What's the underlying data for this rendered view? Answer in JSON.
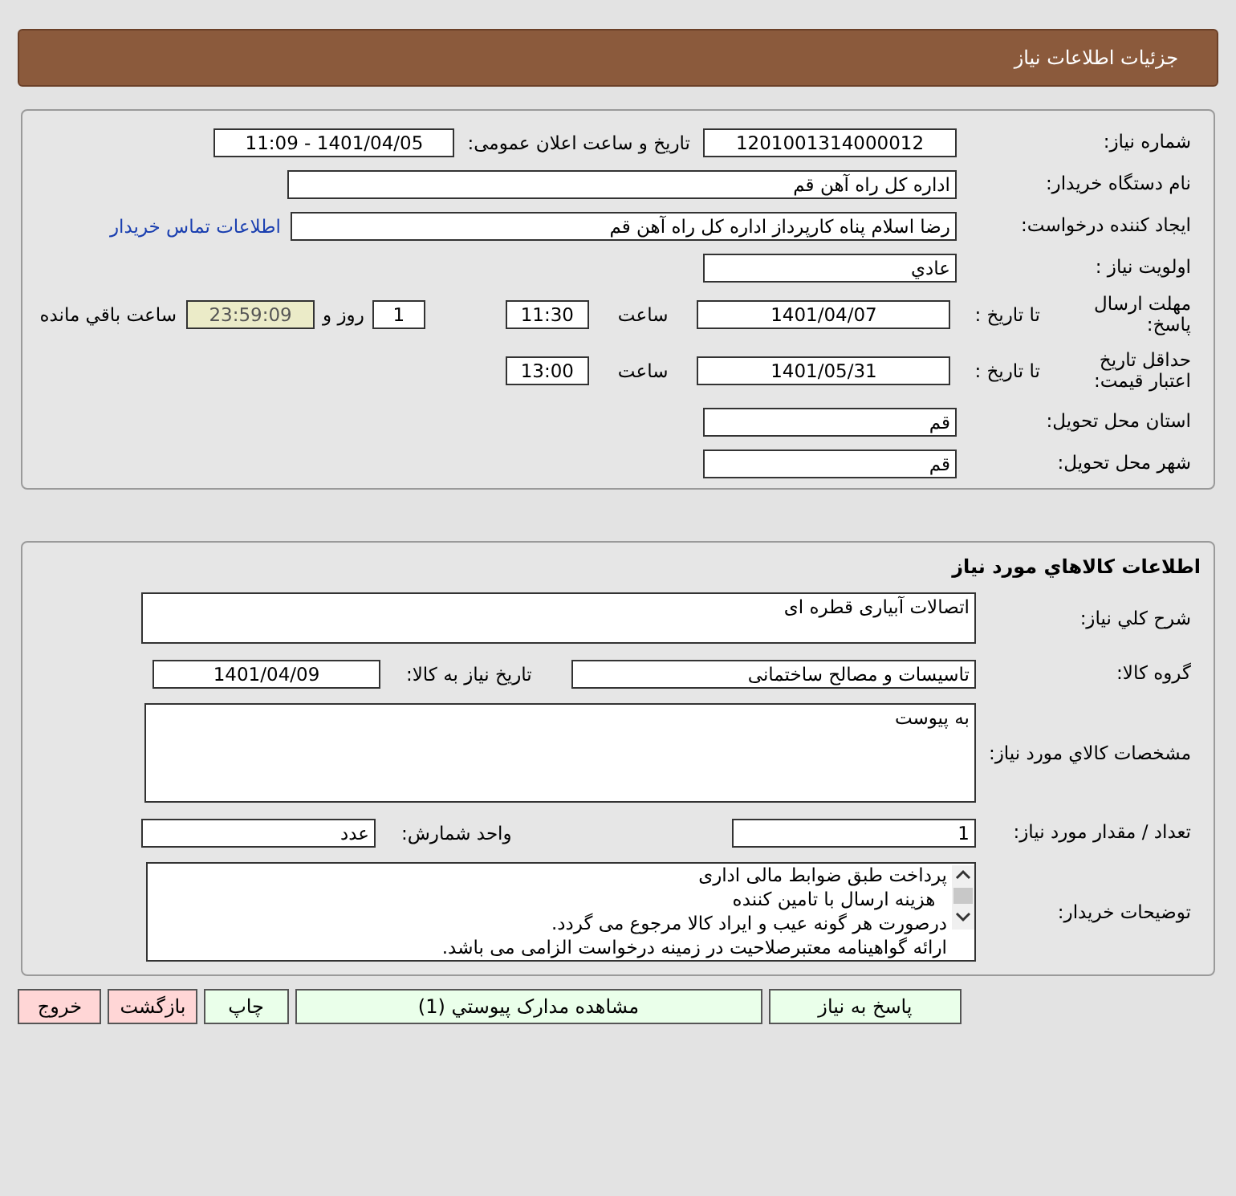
{
  "header": {
    "title": "جزئیات اطلاعات نیاز"
  },
  "need_details": {
    "need_number": {
      "label": "شماره نیاز:",
      "value": "1201001314000012"
    },
    "announce": {
      "label": "تاريخ و ساعت اعلان عمومی:",
      "value": "1401/04/05 - 11:09"
    },
    "buyer_org": {
      "label": "نام دستگاه خريدار:",
      "value": "اداره کل  راه آهن قم"
    },
    "requester": {
      "label": "ايجاد کننده درخواست:",
      "value": "رضا اسلام پناه کارپرداز اداره کل  راه آهن قم",
      "link": "اطلاعات تماس خريدار"
    },
    "priority": {
      "label": "اولويت نياز :",
      "value": "عادي"
    },
    "response_deadline": {
      "label": "مهلت ارسال پاسخ:",
      "to_date_label": "تا تاريخ :",
      "date": "1401/04/07",
      "time_label": "ساعت",
      "time": "11:30",
      "days": "1",
      "days_suffix": "روز و",
      "remaining": "23:59:09",
      "remaining_suffix": "ساعت باقي مانده"
    },
    "price_validity": {
      "label": "حداقل تاريخ اعتبار قيمت:",
      "to_date_label": "تا تاريخ :",
      "date": "1401/05/31",
      "time_label": "ساعت",
      "time": "13:00"
    },
    "province": {
      "label": "استان محل تحويل:",
      "value": "قم"
    },
    "city": {
      "label": "شهر محل تحويل:",
      "value": "قم"
    }
  },
  "goods": {
    "title": "اطلاعات کالاهاي مورد نياز",
    "description": {
      "label": "شرح کلي نياز:",
      "value": "اتصالات آبیاری قطره ای"
    },
    "group": {
      "label": "گروه کالا:",
      "value": "تاسیسات و مصالح ساختمانی"
    },
    "need_date": {
      "label": "تاريخ نياز به کالا:",
      "value": "1401/04/09"
    },
    "specs": {
      "label": "مشخصات کالاي مورد نياز:",
      "value": "به پیوست"
    },
    "quantity": {
      "label": "تعداد / مقدار مورد نياز:",
      "value": "1"
    },
    "unit": {
      "label": "واحد شمارش:",
      "value": "عدد"
    },
    "buyer_notes": {
      "label": "توضيحات خريدار:",
      "lines": [
        "پرداخت طبق ضوابط مالی اداری",
        "  هزینه ارسال با تامین کننده",
        "درصورت هر گونه عیب و ایراد کالا مرجوع می گردد.",
        "ارائه گواهینامه معتبرصلاحیت در زمینه درخواست الزامی می باشد."
      ]
    }
  },
  "buttons": [
    {
      "label": "پاسخ به نیاز",
      "kind": "action"
    },
    {
      "label": "مشاهده مدارک پیوستي (1)",
      "kind": "action"
    },
    {
      "label": "چاپ",
      "kind": "action"
    },
    {
      "label": "بازگشت",
      "kind": "exit"
    },
    {
      "label": "خروج",
      "kind": "exit"
    }
  ]
}
